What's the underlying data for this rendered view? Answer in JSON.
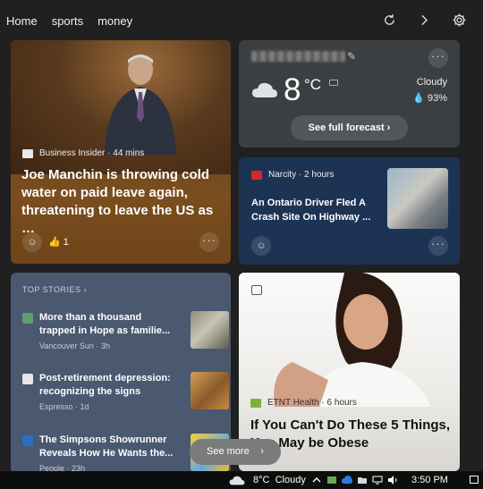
{
  "nav": {
    "items": [
      "Home",
      "sports",
      "money"
    ]
  },
  "toolbar": {
    "refresh_icon": "refresh-icon",
    "next_icon": "chevron-right-icon",
    "settings_icon": "gear-icon"
  },
  "card_main": {
    "source": "Business Insider · 44 mins",
    "headline": "Joe Manchin is throwing cold water on paid leave again, threatening to leave the US as …",
    "reactions": "1",
    "more": "···"
  },
  "weather": {
    "temp": "8",
    "unit": "°C",
    "condition": "Cloudy",
    "humidity": "93%",
    "forecast_label": "See full forecast ›"
  },
  "card_narcity": {
    "source": "Narcity · 2 hours",
    "headline": "An Ontario Driver Fled A Crash Site On Highway ...",
    "more": "···"
  },
  "top_stories": {
    "title": "TOP STORIES ›",
    "items": [
      {
        "title": "More than a thousand trapped in Hope as familie...",
        "source": "Vancouver Sun · 3h"
      },
      {
        "title": "Post-retirement depression: recognizing the signs",
        "source": "Espresso · 1d"
      },
      {
        "title": "The Simpsons Showrunner Reveals How He Wants the...",
        "source": "People · 23h"
      }
    ]
  },
  "card_health": {
    "source": "ETNT Health · 6 hours",
    "headline": "If You Can't Do These 5 Things, You May be Obese"
  },
  "see_more": {
    "label": "See more",
    "chevron": "›"
  },
  "taskbar": {
    "weather": "8°C  Cloudy",
    "time": "3:50 PM"
  },
  "colors": {
    "card_main": "#6a4421",
    "weather": "#3c3f41",
    "narcity": "#1d3354",
    "top_stories": "#4a5870",
    "taskbar": "#0d0d0d"
  }
}
